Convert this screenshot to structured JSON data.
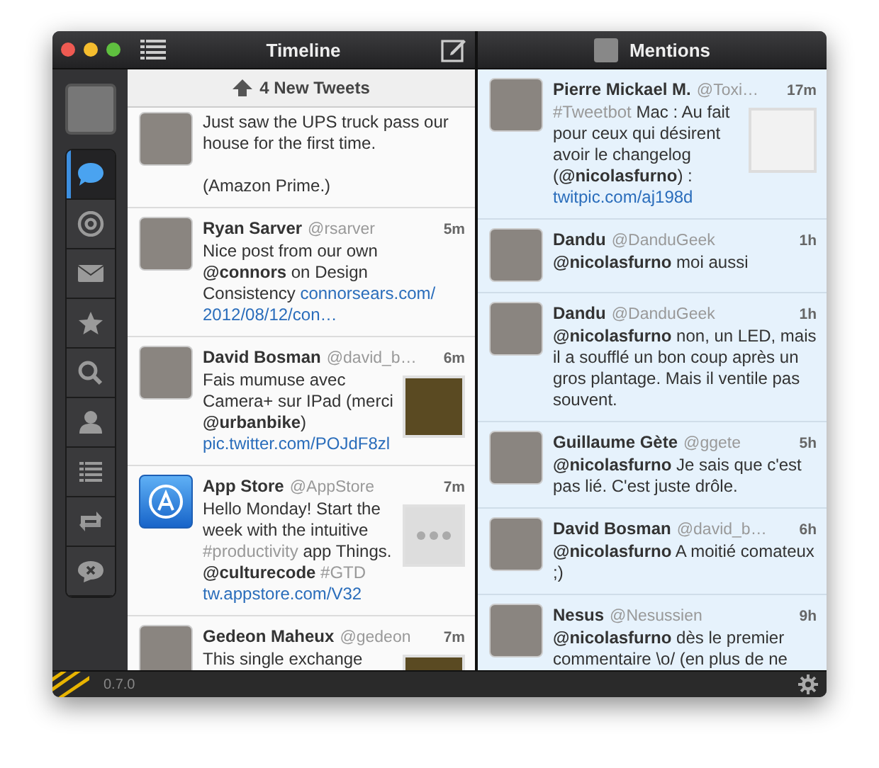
{
  "window": {
    "title": "Timeline"
  },
  "sidebar": {
    "items": [
      {
        "kind": "timeline",
        "selected": true
      },
      {
        "kind": "mentions",
        "selected": false
      },
      {
        "kind": "messages",
        "selected": false
      },
      {
        "kind": "favorites",
        "selected": false
      },
      {
        "kind": "search",
        "selected": false
      },
      {
        "kind": "profile",
        "selected": false
      },
      {
        "kind": "lists",
        "selected": false
      },
      {
        "kind": "retweets",
        "selected": false
      },
      {
        "kind": "muted",
        "selected": false
      }
    ]
  },
  "timeline": {
    "new_tweets": "4 New Tweets",
    "tweets": [
      {
        "avatar": {
          "kind": "photo"
        },
        "body": [
          {
            "kind": "text",
            "text": "Just saw the UPS truck pass our house for the first time."
          }
        ],
        "body_2": "(Amazon Prime.)"
      },
      {
        "name": "Ryan Sarver",
        "handle": "@rsarver",
        "time": "5m",
        "avatar": {
          "kind": "photo"
        },
        "body": [
          {
            "kind": "text",
            "text": "Nice post from our own "
          },
          {
            "kind": "mention",
            "text": "@connors"
          },
          {
            "kind": "text",
            "text": " on Design Consistency "
          },
          {
            "kind": "link",
            "text": "connorsears.com/"
          },
          {
            "kind": "link",
            "text": "2012/08/12/con…"
          }
        ]
      },
      {
        "name": "David Bosman",
        "handle": "@david_b…",
        "time": "6m",
        "avatar": {
          "kind": "photo"
        },
        "thumbnail": {
          "kind": "photo"
        },
        "body": [
          {
            "kind": "text",
            "text": "Fais mumuse avec Camera+ sur IPad (merci "
          },
          {
            "kind": "mention",
            "text": "@urbanbike"
          },
          {
            "kind": "text",
            "text": ") "
          },
          {
            "kind": "link",
            "text": "pic.twitter.com/"
          },
          {
            "kind": "link",
            "text": "POJdF8zl"
          }
        ]
      },
      {
        "name": "App Store",
        "handle": "@AppStore",
        "time": "7m",
        "avatar": {
          "kind": "app"
        },
        "thumbnail": {
          "kind": "more"
        },
        "body": [
          {
            "kind": "text",
            "text": "Hello Monday! Start the week with the intuitive "
          },
          {
            "kind": "hashtag",
            "text": "#productivity"
          },
          {
            "kind": "text",
            "text": " app Things. "
          },
          {
            "kind": "mention",
            "text": "@culturecode"
          },
          {
            "kind": "hashtag",
            "text": " #GTD"
          },
          {
            "kind": "link",
            "text": "tw.appstore.com/V32"
          }
        ]
      },
      {
        "name": "Gedeon Maheux",
        "handle": "@gedeon",
        "time": "7m",
        "avatar": {
          "kind": "photo"
        },
        "thumbnail": {
          "kind": "photo"
        },
        "body": [
          {
            "kind": "text",
            "text": "This single exchange"
          }
        ]
      }
    ]
  },
  "mentions": {
    "title": "Mentions",
    "tweets": [
      {
        "name": "Pierre Mickael M.",
        "handle": "@Toxi…",
        "time": "17m",
        "avatar": {
          "kind": "photo"
        },
        "thumbnail": {
          "kind": "screenshot"
        },
        "body": [
          {
            "kind": "hashtag",
            "text": "#Tweetbot"
          },
          {
            "kind": "text",
            "text": " Mac : Au fait pour ceux qui désirent avoir le changelog ("
          },
          {
            "kind": "mention",
            "text": "@nicolasfurno"
          },
          {
            "kind": "text",
            "text": ") : "
          },
          {
            "kind": "link",
            "text": "twitpic.com/aj198d"
          }
        ]
      },
      {
        "name": "Dandu",
        "handle": "@DanduGeek",
        "time": "1h",
        "avatar": {
          "kind": "photo"
        },
        "body": [
          {
            "kind": "mention",
            "text": "@nicolasfurno"
          },
          {
            "kind": "text",
            "text": " moi aussi"
          }
        ]
      },
      {
        "name": "Dandu",
        "handle": "@DanduGeek",
        "time": "1h",
        "avatar": {
          "kind": "photo"
        },
        "body": [
          {
            "kind": "mention",
            "text": "@nicolasfurno"
          },
          {
            "kind": "text",
            "text": " non, un LED, mais il a soufflé un bon coup après un gros plantage. Mais il ventile pas souvent."
          }
        ]
      },
      {
        "name": "Guillaume Gète",
        "handle": "@ggete",
        "time": "5h",
        "avatar": {
          "kind": "photo"
        },
        "body": [
          {
            "kind": "mention",
            "text": "@nicolasfurno"
          },
          {
            "kind": "text",
            "text": " Je sais que c'est pas lié. C'est juste drôle."
          }
        ]
      },
      {
        "name": "David Bosman",
        "handle": "@david_b…",
        "time": "6h",
        "avatar": {
          "kind": "photo"
        },
        "body": [
          {
            "kind": "mention",
            "text": "@nicolasfurno"
          },
          {
            "kind": "text",
            "text": " A moitié comateux ;)"
          }
        ]
      },
      {
        "name": "Nesus",
        "handle": "@Nesussien",
        "time": "9h",
        "avatar": {
          "kind": "photo"
        },
        "body": [
          {
            "kind": "mention",
            "text": "@nicolasfurno"
          },
          {
            "kind": "text",
            "text": " dès le premier commentaire \\o/ (en plus de ne"
          }
        ]
      }
    ]
  },
  "status_bar": {
    "version": "0.7.0"
  }
}
